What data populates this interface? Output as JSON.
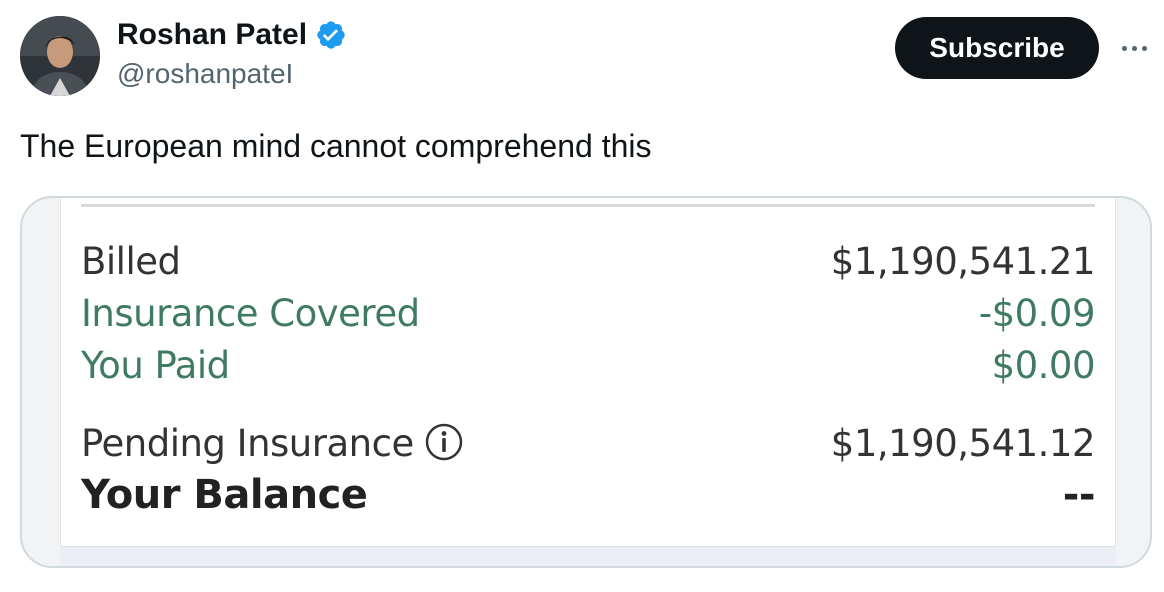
{
  "tweet": {
    "author": {
      "display_name": "Roshan Patel",
      "handle": "@roshanpateI",
      "verified": true,
      "verified_color": "#1d9bf0"
    },
    "subscribe_label": "Subscribe",
    "more_icon": "more-horizontal-icon",
    "text": "The European mind cannot comprehend this"
  },
  "receipt": {
    "rows": [
      {
        "label": "Billed",
        "value": "$1,190,541.21"
      },
      {
        "label": "Insurance Covered",
        "value": "-$0.09"
      },
      {
        "label": "You Paid",
        "value": "$0.00"
      },
      {
        "label": "Pending Insurance",
        "value": "$1,190,541.12",
        "icon": "info-icon"
      },
      {
        "label": "Your Balance",
        "value": "--"
      }
    ],
    "colors": {
      "dark_text": "#333333",
      "green_text": "#3f7b60"
    }
  }
}
